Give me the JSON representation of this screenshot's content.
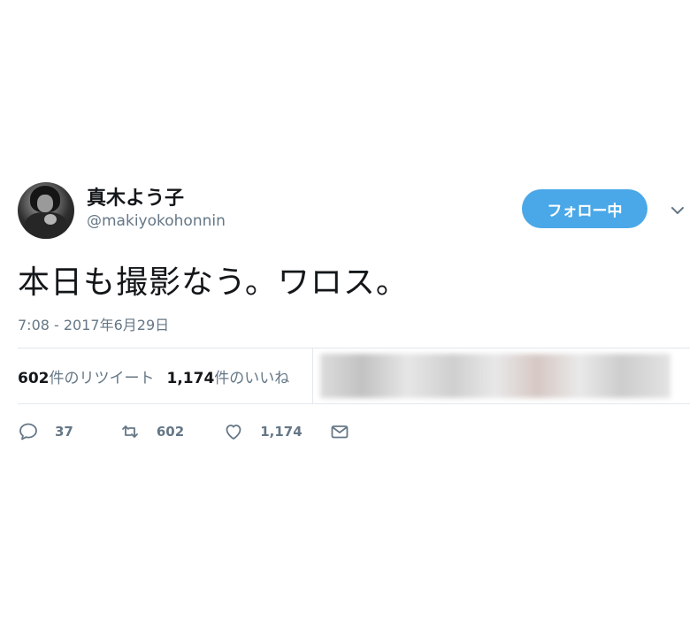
{
  "user": {
    "display_name": "真木よう子",
    "screen_name": "@makiyokohonnin"
  },
  "follow_button": {
    "label": "フォロー中"
  },
  "tweet": {
    "text": "本日も撮影なう。ワロス。",
    "timestamp": "7:08 - 2017年6月29日"
  },
  "stats": {
    "retweets_count": "602",
    "retweets_label": "件のリツイート",
    "likes_count": "1,174",
    "likes_label": "件のいいね"
  },
  "actions": {
    "reply_count": "37",
    "retweet_count": "602",
    "like_count": "1,174"
  },
  "icons": [
    "avatar",
    "chevron-down-icon",
    "reply-icon",
    "retweet-icon",
    "heart-icon",
    "mail-icon"
  ],
  "colors": {
    "follow_button_bg": "#4aa8e8",
    "secondary_text": "#657786",
    "divider": "#e1e8ed"
  }
}
